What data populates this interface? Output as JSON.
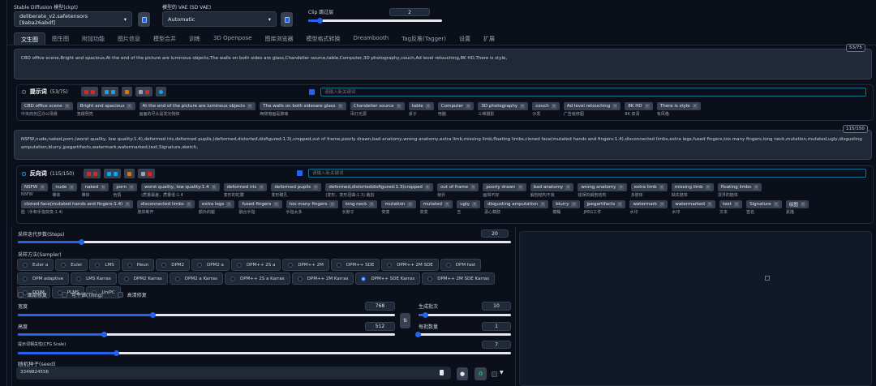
{
  "header": {
    "ckpt_label": "Stable Diffusion 模型(ckpt)",
    "ckpt_value": "deliberate_v2.safetensors [9aba26abdf]",
    "vae_label": "模型的 VAE (SD VAE)",
    "vae_value": "Automatic",
    "clip_label": "Clip 跳过层",
    "clip_value": "2",
    "clip_fraction": 0.09
  },
  "tabs": [
    "文生图",
    "图生图",
    "附加功能",
    "图片信息",
    "模型合并",
    "训练",
    "3D Openpose",
    "图库浏览器",
    "模型格式转换",
    "Dreambooth",
    "Tag反推(Tagger)",
    "设置",
    "扩展"
  ],
  "active_tab": 0,
  "prompt": {
    "text": "CBD office scene,Bright and spacious,At the end of the picture are luminous objects,The walls on both sides are glass,Chandelier source,table,Computer,3D photography,couch,Ad level retouching,8K HD,There is style,",
    "counter": "53/75",
    "title": "提示词",
    "title_count": "(53/75)",
    "keyword_placeholder": "请输入新关键词",
    "tags": [
      {
        "en": "CBD office scene",
        "zh": "中央商务区办公场景"
      },
      {
        "en": "Bright and spacious",
        "zh": "宽敞明亮"
      },
      {
        "en": "At the end of the picture are luminous objects",
        "zh": "画面的尽头是发光物体"
      },
      {
        "en": "The walls on both sidesare glass",
        "zh": "两侧墙面是玻璃"
      },
      {
        "en": "Chandelier source",
        "zh": "吊灯光源"
      },
      {
        "en": "table",
        "zh": "桌子"
      },
      {
        "en": "Computer",
        "zh": "电脑"
      },
      {
        "en": "3D photography",
        "zh": "三维摄影"
      },
      {
        "en": "couch",
        "zh": "沙发"
      },
      {
        "en": "Ad level retouching",
        "zh": "广告级修图"
      },
      {
        "en": "8K HD",
        "zh": "8K 高清"
      },
      {
        "en": "There is style",
        "zh": "有风格"
      }
    ]
  },
  "negative": {
    "text": "NSFW,nude,naked,porn,(worst quality, low quality:1.4),deformed iris,deformed pupils,(deformed,distorted,disfigured:1.3),cropped,out of frame,poorly drawn,bad anatomy,wrong anatomy,extra limb,missing limb,floating limbs,cloned face(mutated hands and fingers:1.4),disconnected limbs,extra legs,fused fingers,too many fingers,long neck,mutation,mutated,ugly,disgusting amputation,blurry,jpegartifacts,watermark,watermarked,text,Signature,sketch,",
    "counter": "115/150",
    "title": "反向词",
    "title_count": "(115/150)",
    "keyword_placeholder": "请输入新关键词",
    "tags": [
      {
        "en": "NSFW",
        "zh": "NSFW"
      },
      {
        "en": "nude",
        "zh": "裸体"
      },
      {
        "en": "naked",
        "zh": "裸体"
      },
      {
        "en": "porn",
        "zh": "色情"
      },
      {
        "en": "worst quality, low quality:1.4",
        "zh": "(质量最差，质量低:1.4"
      },
      {
        "en": "deformed iris",
        "zh": "变形的虹膜"
      },
      {
        "en": "deformed pupils",
        "zh": "变形瞳孔"
      },
      {
        "en": "deformed,distorteddisfigured:1.3)cropped",
        "zh": "(变形，变形扭曲:1.3) 裁剪"
      },
      {
        "en": "out of frame",
        "zh": "帧外"
      },
      {
        "en": "poorly drawn",
        "zh": "画得不好"
      },
      {
        "en": "bad anatomy",
        "zh": "解剖结构不良"
      },
      {
        "en": "wrong anatomy",
        "zh": "错误的解剖结构"
      },
      {
        "en": "extra limb",
        "zh": "多肢体"
      },
      {
        "en": "missing limb",
        "zh": "缺失肢体"
      },
      {
        "en": "floating limbs",
        "zh": "漂浮的肢体"
      },
      {
        "en": "cloned face(mutated hands and fingers:1.4)",
        "zh": "脸（手和手指突变:1.4)"
      },
      {
        "en": "disconnected limbs",
        "zh": "肢体断开"
      },
      {
        "en": "extra legs",
        "zh": "额外的腿"
      },
      {
        "en": "fused fingers",
        "zh": "融合手指"
      },
      {
        "en": "too many fingers",
        "zh": "手指太多"
      },
      {
        "en": "long neck",
        "zh": "长脖子"
      },
      {
        "en": "mutation",
        "zh": "突变"
      },
      {
        "en": "mutated",
        "zh": "突变"
      },
      {
        "en": "ugly",
        "zh": "丑"
      },
      {
        "en": "disgusting amputation",
        "zh": "恶心截肢"
      },
      {
        "en": "blurry",
        "zh": "模糊"
      },
      {
        "en": "jpegartifacts",
        "zh": "JPEG工件"
      },
      {
        "en": "watermark",
        "zh": "水印"
      },
      {
        "en": "watermarked",
        "zh": "水印"
      },
      {
        "en": "text",
        "zh": "文本"
      },
      {
        "en": "Signature",
        "zh": "签名"
      },
      {
        "en": "绘图",
        "zh": "素描"
      }
    ]
  },
  "params": {
    "steps_label": "采样迭代步数(Steps)",
    "steps": "20",
    "steps_fraction": 0.13,
    "sampler_label": "采样方法(Sampler)",
    "samplers": [
      "Euler a",
      "Euler",
      "LMS",
      "Heun",
      "DPM2",
      "DPM2 a",
      "DPM++ 2S a",
      "DPM++ 2M",
      "DPM++ SDE",
      "DPM++ 2M SDE",
      "DPM fast",
      "DPM adaptive",
      "LMS Karras",
      "DPM2 Karras",
      "DPM2 a Karras",
      "DPM++ 2S a Karras",
      "DPM++ 2M Karras",
      "DPM++ SDE Karras",
      "DPM++ 2M SDE Karras",
      "DDIM",
      "PLMS",
      "UniPC"
    ],
    "selected_sampler": "DPM++ SDE Karras",
    "checkboxes": [
      "面部修复",
      "可平铺(Tiling)",
      "高清修复"
    ],
    "width_label": "宽度",
    "width": "768",
    "width_fraction": 0.36,
    "height_label": "高度",
    "height": "512",
    "height_fraction": 0.23,
    "batch_count_label": "生成批次",
    "batch_count": "10",
    "batch_count_fraction": 0.08,
    "batch_size_label": "每批数量",
    "batch_size": "1",
    "batch_size_fraction": 0.0,
    "cfg_label": "提示词相关性(CFG Scale)",
    "cfg": "7",
    "cfg_fraction": 0.2,
    "seed_label": "随机种子(seed)",
    "seed": "3349824556"
  },
  "colors": {
    "accent": "#2563eb",
    "bg": "#0b0f19",
    "panel": "#1f2937"
  }
}
